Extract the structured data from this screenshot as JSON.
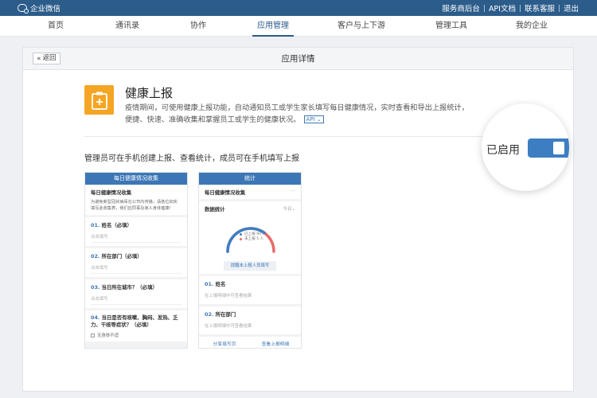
{
  "topbar": {
    "brand": "企业微信",
    "links": [
      "服务商后台",
      "API文档",
      "联系客服",
      "退出"
    ]
  },
  "nav": {
    "items": [
      "首页",
      "通讯录",
      "协作",
      "应用管理",
      "客户与上下游",
      "管理工具",
      "我的企业"
    ],
    "active_index": 3
  },
  "panel": {
    "back_label": "返回",
    "title": "应用详情"
  },
  "app": {
    "name": "健康上报",
    "description": "疫情期间，可使用健康上报功能，自动通知员工或学生家长填写每日健康情况，实时查看和导出上报统计，便捷、快速、准确收集和掌握员工或学生的健康状况。",
    "api_tag": "API",
    "status": "已启用",
    "enabled": true,
    "icon_color": "#f5a524"
  },
  "subtitle": "管理员可在手机创建上报、查看统计，成员可在手机填写上报",
  "phone1": {
    "header": "每日健康情况收集",
    "form_title": "每日健康情况收集",
    "form_note": "为避免新型冠状病毒在公司内传播，请各位如实填写此收集表，我们应同事及家人身体健康！",
    "questions": [
      {
        "num": "01.",
        "text": "姓名（必填）",
        "placeholder": "点击填写"
      },
      {
        "num": "02.",
        "text": "所在部门（必填）",
        "placeholder": "点击填写"
      },
      {
        "num": "03.",
        "text": "当日所在城市？（必填）",
        "placeholder": "点击填写"
      },
      {
        "num": "04.",
        "text": "当日是否有咳嗽、胸闷、发热、乏力、干咳等症状？（必填）",
        "option": "无身体不适"
      }
    ]
  },
  "phone2": {
    "header": "统计",
    "form_title": "每日健康情况收集",
    "more": "···",
    "stats_label": "数据统计",
    "range": "今日",
    "legend": [
      {
        "label": "已上报 90 人",
        "color": "#3d7ec2"
      },
      {
        "label": "未上报 5 人",
        "color": "#e86a6a"
      }
    ],
    "reported_fraction": 0.7,
    "remind_button": "提醒未上报人员填写",
    "fields": [
      {
        "num": "01.",
        "text": "姓名",
        "hint": "在上报明细中可查看结果"
      },
      {
        "num": "02.",
        "text": "所在部门",
        "hint": "在上报明细中可查看结果"
      }
    ],
    "footer": [
      "分享填写页",
      "查看上报明细"
    ]
  },
  "colors": {
    "topbar": "#2b5c8a",
    "accent": "#3d76b5"
  }
}
